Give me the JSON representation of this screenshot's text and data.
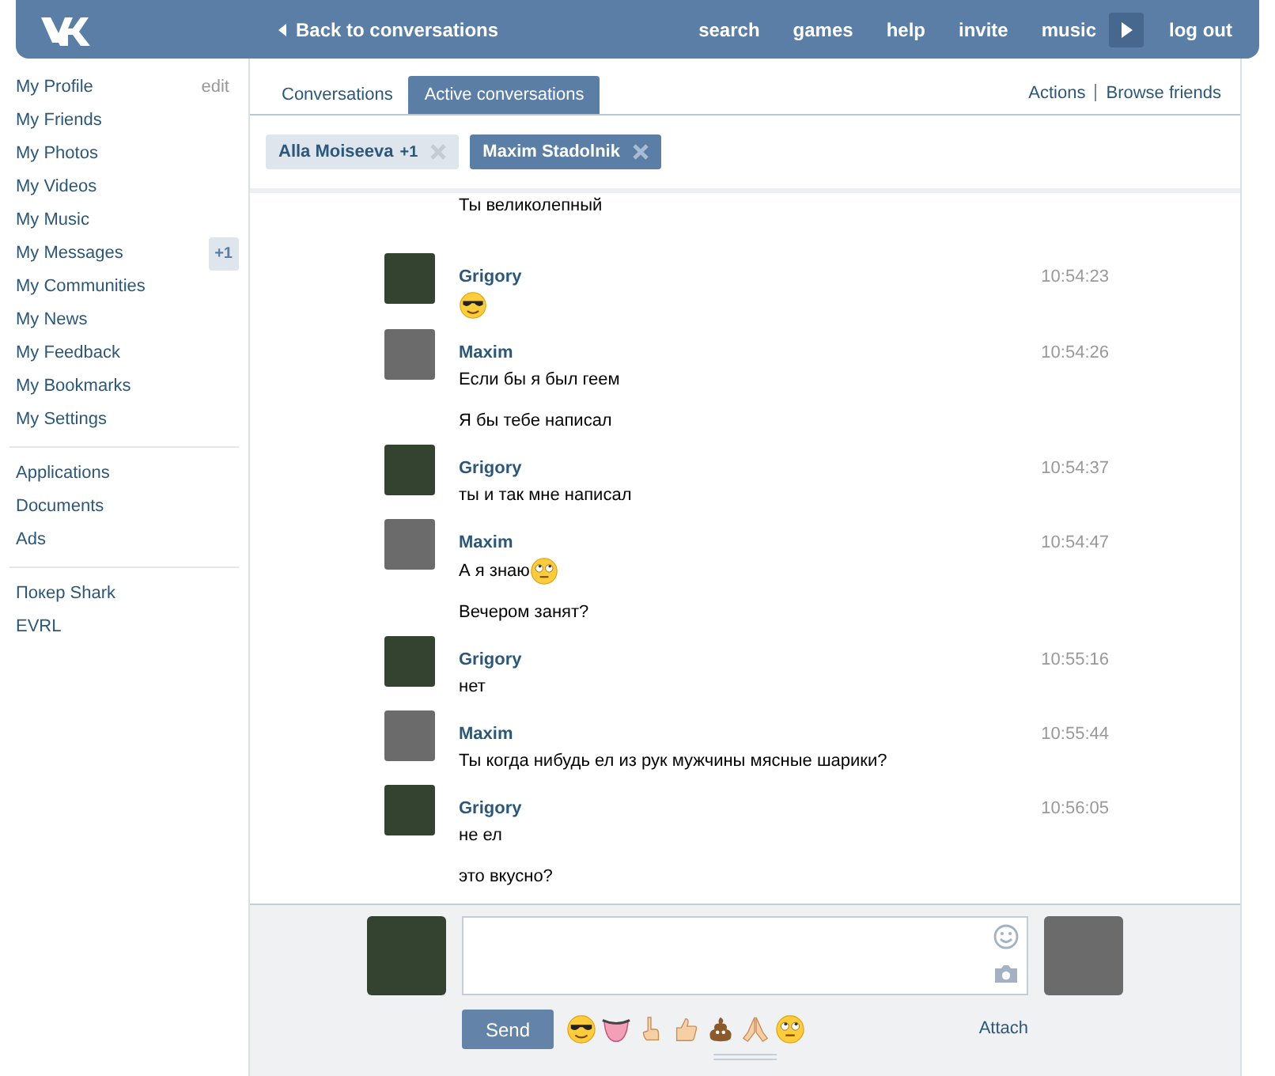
{
  "header": {
    "back": "Back to conversations",
    "nav": [
      {
        "label": "search",
        "kind": "link"
      },
      {
        "label": "games",
        "kind": "link"
      },
      {
        "label": "help",
        "kind": "link"
      },
      {
        "label": "invite",
        "kind": "link"
      },
      {
        "label": "music",
        "kind": "link"
      },
      {
        "kind": "play"
      },
      {
        "label": "log out",
        "kind": "link"
      }
    ]
  },
  "sidebar": {
    "sections": [
      [
        {
          "label": "My Profile",
          "extra": "edit"
        },
        {
          "label": "My Friends"
        },
        {
          "label": "My Photos"
        },
        {
          "label": "My Videos"
        },
        {
          "label": "My Music"
        },
        {
          "label": "My Messages",
          "badge": "+1"
        },
        {
          "label": "My Communities"
        },
        {
          "label": "My News"
        },
        {
          "label": "My Feedback"
        },
        {
          "label": "My Bookmarks"
        },
        {
          "label": "My Settings"
        }
      ],
      [
        {
          "label": "Applications"
        },
        {
          "label": "Documents"
        },
        {
          "label": "Ads"
        }
      ],
      [
        {
          "label": "Покер Shark"
        },
        {
          "label": "EVRL"
        }
      ]
    ]
  },
  "tabs": [
    {
      "label": "Conversations",
      "selected": false
    },
    {
      "label": "Active conversations",
      "selected": true
    }
  ],
  "actions": [
    "Actions",
    "Browse friends"
  ],
  "chips": [
    {
      "name": "Alla Moiseeva",
      "count": "+1",
      "selected": false
    },
    {
      "name": "Maxim Stadolnik",
      "selected": true
    }
  ],
  "messages": [
    {
      "lines": [
        {
          "kind": "text",
          "text": "Ты великолепный"
        }
      ]
    },
    {
      "author": "Grigory",
      "time": "10:54:23",
      "color": "#34432f",
      "lines": [
        {
          "kind": "sticker"
        }
      ]
    },
    {
      "author": "Maxim",
      "time": "10:54:26",
      "color": "#6b6b6b",
      "lines": [
        {
          "kind": "text",
          "text": "Если бы я был геем"
        },
        {
          "kind": "text",
          "text": "Я бы тебе написал"
        }
      ]
    },
    {
      "author": "Grigory",
      "time": "10:54:37",
      "color": "#34432f",
      "lines": [
        {
          "kind": "text",
          "text": "ты и так мне написал"
        }
      ]
    },
    {
      "author": "Maxim",
      "time": "10:54:47",
      "color": "#6b6b6b",
      "lines": [
        {
          "kind": "text_emoji",
          "text": "А я знаю"
        },
        {
          "kind": "text",
          "text": "Вечером занят?"
        }
      ]
    },
    {
      "author": "Grigory",
      "time": "10:55:16",
      "color": "#34432f",
      "lines": [
        {
          "kind": "text",
          "text": "нет"
        }
      ]
    },
    {
      "author": "Maxim",
      "time": "10:55:44",
      "color": "#6b6b6b",
      "lines": [
        {
          "kind": "text",
          "text": "Ты когда нибудь ел из рук мужчины мясные шарики?"
        }
      ]
    },
    {
      "author": "Grigory",
      "time": "10:56:05",
      "color": "#34432f",
      "lines": [
        {
          "kind": "text",
          "text": "не ел"
        },
        {
          "kind": "text",
          "text": "это вкусно?"
        }
      ]
    }
  ],
  "compose": {
    "send": "Send",
    "attach": "Attach",
    "avatars": [
      {
        "color": "#34432f"
      },
      {
        "color": "#6b6b6b"
      }
    ]
  }
}
